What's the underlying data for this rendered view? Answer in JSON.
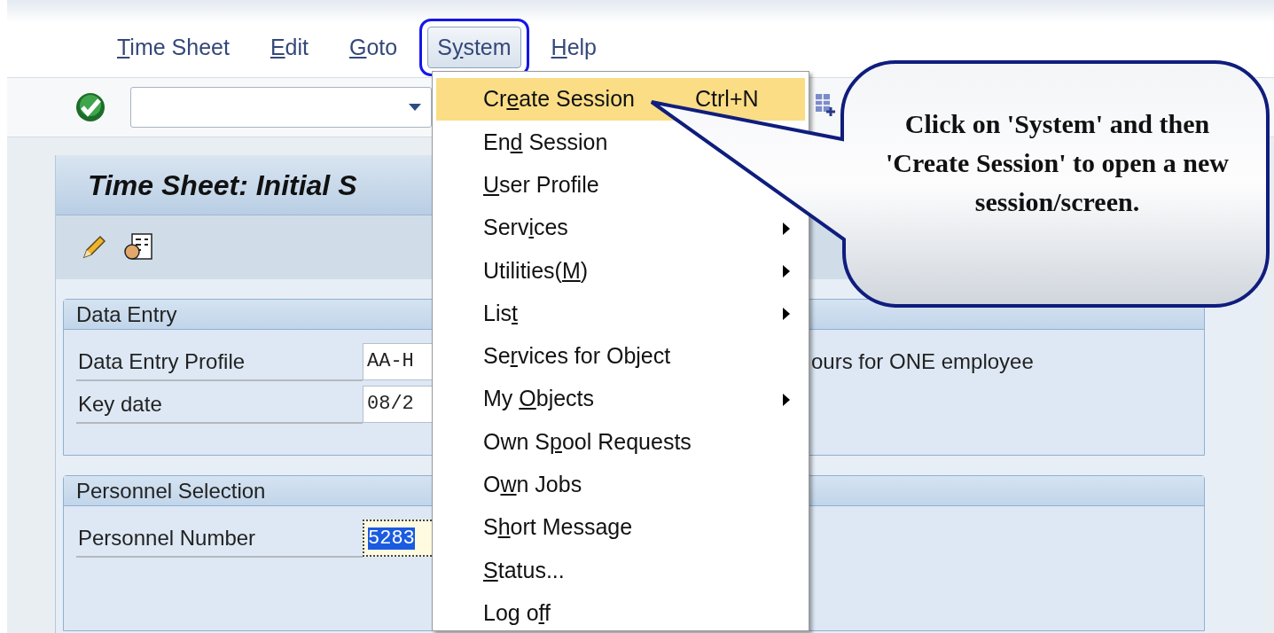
{
  "menu_bar": [
    {
      "key": "T",
      "after": "ime Sheet",
      "selected": false
    },
    {
      "key": "E",
      "after": "dit",
      "selected": false
    },
    {
      "key": "G",
      "after": "oto",
      "selected": false
    },
    {
      "before": "S",
      "key": "y",
      "after": "stem",
      "selected": true
    },
    {
      "key": "H",
      "after": "elp",
      "selected": false
    }
  ],
  "screen": {
    "title": "Time Sheet: Initial S"
  },
  "groups": [
    {
      "title": "Data Entry",
      "fields": [
        {
          "label": "Data Entry Profile",
          "value": "AA-H",
          "selected": false,
          "note": "ours for ONE employee"
        },
        {
          "label": "Key date",
          "value": "08/2",
          "selected": false
        }
      ]
    },
    {
      "title": "Personnel Selection",
      "fields": [
        {
          "label": "Personnel Number",
          "value": "5283",
          "selected": true
        }
      ]
    }
  ],
  "dropdown_menu": {
    "items": [
      {
        "before": "Cr",
        "key": "e",
        "after": "ate Session",
        "shortcut": "Ctrl+N",
        "submenu": false,
        "selected": true
      },
      {
        "before": "En",
        "key": "d",
        "after": " Session",
        "submenu": false,
        "selected": false
      },
      {
        "key": "U",
        "after": "ser Profile",
        "submenu": false,
        "selected": false
      },
      {
        "before": "Serv",
        "key": "i",
        "after": "ces",
        "submenu": true,
        "selected": false
      },
      {
        "before": "Utilities(",
        "key": "M",
        "after": ")",
        "submenu": true,
        "selected": false
      },
      {
        "before": "Lis",
        "key": "t",
        "submenu": true,
        "selected": false
      },
      {
        "before": "Se",
        "key": "r",
        "after": "vices for Object",
        "submenu": false,
        "selected": false
      },
      {
        "before": "My ",
        "key": "O",
        "after": "bjects",
        "submenu": true,
        "selected": false
      },
      {
        "before": "Own S",
        "key": "p",
        "after": "ool Requests",
        "submenu": false,
        "selected": false
      },
      {
        "before": "O",
        "key": "w",
        "after": "n Jobs",
        "submenu": false,
        "selected": false
      },
      {
        "before": "S",
        "key": "h",
        "after": "ort Message",
        "submenu": false,
        "selected": false
      },
      {
        "key": "S",
        "after": "tatus...",
        "submenu": false,
        "selected": false
      },
      {
        "before": "Log o",
        "key": "f",
        "after": "f",
        "submenu": false,
        "selected": false
      }
    ]
  },
  "callout": {
    "text": "Click on 'System' and then 'Create Session' to open a new session/screen."
  }
}
